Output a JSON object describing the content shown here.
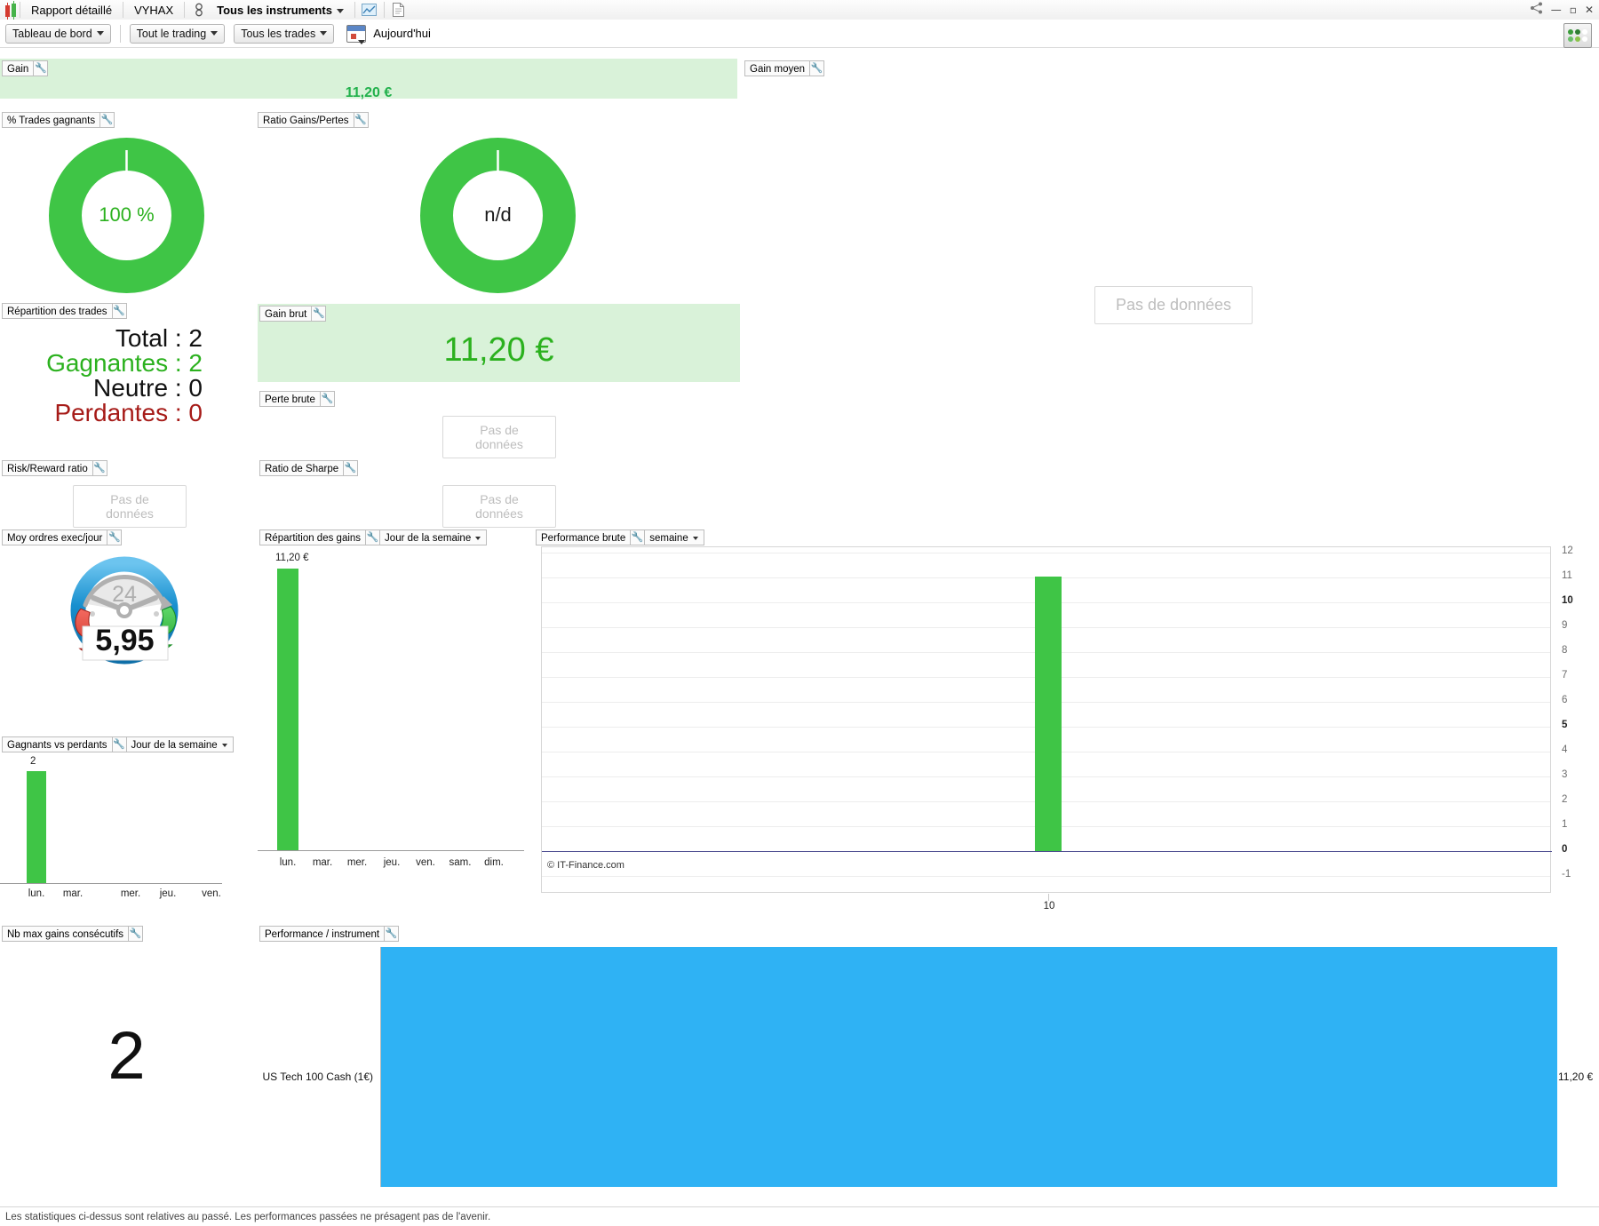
{
  "titlebar": {
    "app_icon": "candlestick-logo-icon",
    "report_label": "Rapport détaillé",
    "account_label": "VYHAX",
    "instrument_icon": "instrument-icon",
    "instrument_selector": "Tous les instruments",
    "chart_icon": "chart-window-icon",
    "doc_icon": "document-icon",
    "share_icon": "share-icon",
    "minimize": "—",
    "maximize": "▫",
    "close": "✕"
  },
  "toolbar": {
    "dashboard": "Tableau de bord",
    "all_trading": "Tout le trading",
    "all_trades": "Tous les trades",
    "calendar_icon": "calendar-icon",
    "today": "Aujourd'hui",
    "export_icon": "export-icon"
  },
  "widgets": {
    "gain": {
      "title": "Gain",
      "value": "11,20 €"
    },
    "gain_moyen": {
      "title": "Gain moyen",
      "empty": "Pas de données"
    },
    "pct_trades_gagnants": {
      "title": "% Trades gagnants",
      "value": "100 %",
      "percent": 100
    },
    "ratio_gains_pertes": {
      "title": "Ratio Gains/Pertes",
      "value": "n/d",
      "percent": 100
    },
    "repartition_trades": {
      "title": "Répartition des trades",
      "rows": [
        {
          "label": "Total",
          "value": "2",
          "color": "#111111"
        },
        {
          "label": "Gagnantes",
          "value": "2",
          "color": "#2bb11e"
        },
        {
          "label": "Neutre",
          "value": "0",
          "color": "#111111"
        },
        {
          "label": "Perdantes",
          "value": "0",
          "color": "#a61b18"
        }
      ]
    },
    "gain_brut": {
      "title": "Gain brut",
      "value": "11,20 €"
    },
    "perte_brute": {
      "title": "Perte brute",
      "empty": "Pas de données"
    },
    "risk_reward": {
      "title": "Risk/Reward ratio",
      "empty": "Pas de données"
    },
    "ratio_sharpe": {
      "title": "Ratio de Sharpe",
      "empty": "Pas de données"
    },
    "moy_ordres": {
      "title": "Moy ordres exec/jour",
      "value": "5,95",
      "dial_label": "24"
    },
    "gagnants_vs_perdants": {
      "title": "Gagnants vs perdants",
      "dropdown": "Jour de la semaine"
    },
    "nb_max_gains": {
      "title": "Nb max gains consécutifs",
      "value": "2"
    },
    "repartition_gains": {
      "title": "Répartition des gains",
      "dropdown": "Jour de la semaine"
    },
    "performance_brute": {
      "title": "Performance brute",
      "dropdown": "semaine",
      "credit": "© IT-Finance.com"
    },
    "performance_instrument": {
      "title": "Performance / instrument"
    }
  },
  "chart_data": [
    {
      "id": "gagnants-vs-perdants",
      "type": "bar",
      "title": "Gagnants vs perdants",
      "categories": [
        "lun.",
        "mar.",
        "mer.",
        "jeu.",
        "ven."
      ],
      "values": [
        2,
        0,
        0,
        0,
        0
      ],
      "labels": [
        "2",
        "",
        "",
        "",
        ""
      ],
      "ylim": [
        0,
        2.3
      ],
      "color": "#3fc546",
      "xlabel": "",
      "ylabel": ""
    },
    {
      "id": "repartition-des-gains",
      "type": "bar",
      "title": "Répartition des gains",
      "categories": [
        "lun.",
        "mar.",
        "mer.",
        "jeu.",
        "ven.",
        "sam.",
        "dim."
      ],
      "values": [
        11.2,
        0,
        0,
        0,
        0,
        0,
        0
      ],
      "labels": [
        "11,20 €",
        "",
        "",
        "",
        "",
        "",
        ""
      ],
      "ylim": [
        0,
        12.4
      ],
      "color": "#3fc546",
      "xlabel": "",
      "ylabel": ""
    },
    {
      "id": "performance-brute",
      "type": "bar",
      "title": "Performance brute",
      "period": "semaine",
      "categories": [
        "10"
      ],
      "values": [
        11.2
      ],
      "yticks": [
        12,
        11,
        10,
        9,
        8,
        7,
        6,
        5,
        4,
        3,
        2,
        1,
        0,
        -1
      ],
      "ybold": [
        10,
        5,
        0
      ],
      "ylim": [
        -1,
        12
      ],
      "grid": true,
      "color": "#3fc546",
      "xlabel": "",
      "ylabel": ""
    },
    {
      "id": "performance-instrument",
      "type": "bar",
      "title": "Performance / instrument",
      "orientation": "horizontal",
      "categories": [
        "US Tech 100 Cash (1€)"
      ],
      "values": [
        11.2
      ],
      "value_labels": [
        "11,20 €"
      ],
      "color": "#2fb2f4",
      "xlabel": "",
      "ylabel": ""
    }
  ],
  "footer": {
    "disclaimer": "Les statistiques ci-dessus sont relatives au passé. Les performances passées ne présagent pas de l'avenir."
  }
}
